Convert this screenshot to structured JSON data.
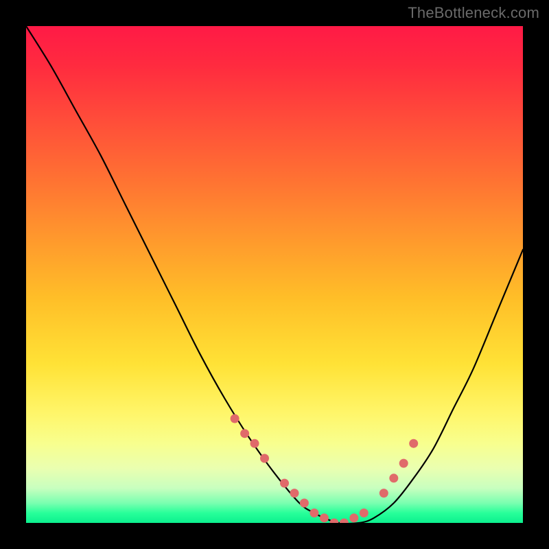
{
  "watermark": "TheBottleneck.com",
  "colors": {
    "page_bg": "#000000",
    "marker": "#e06a6a",
    "curve": "#000000"
  },
  "chart_data": {
    "type": "line",
    "title": "",
    "xlabel": "",
    "ylabel": "",
    "xlim": [
      0,
      100
    ],
    "ylim": [
      0,
      100
    ],
    "grid": false,
    "legend": false,
    "note": "Values are approximate percentages read from pixel positions; no numeric axes are shown in the source image.",
    "x": [
      0,
      5,
      10,
      15,
      20,
      25,
      30,
      35,
      40,
      45,
      50,
      55,
      58,
      60,
      63,
      67,
      70,
      74,
      78,
      82,
      86,
      90,
      95,
      100
    ],
    "bottleneck_pct": [
      100,
      92,
      83,
      74,
      64,
      54,
      44,
      34,
      25,
      17,
      10,
      4,
      2,
      1,
      0,
      0,
      1,
      4,
      9,
      15,
      23,
      31,
      43,
      55
    ],
    "markers": {
      "x": [
        42,
        44,
        46,
        48,
        52,
        54,
        56,
        58,
        60,
        62,
        64,
        66,
        68,
        72,
        74,
        76,
        78
      ],
      "bottleneck_pct": [
        21,
        18,
        16,
        13,
        8,
        6,
        4,
        2,
        1,
        0,
        0,
        1,
        2,
        6,
        9,
        12,
        16
      ]
    }
  }
}
